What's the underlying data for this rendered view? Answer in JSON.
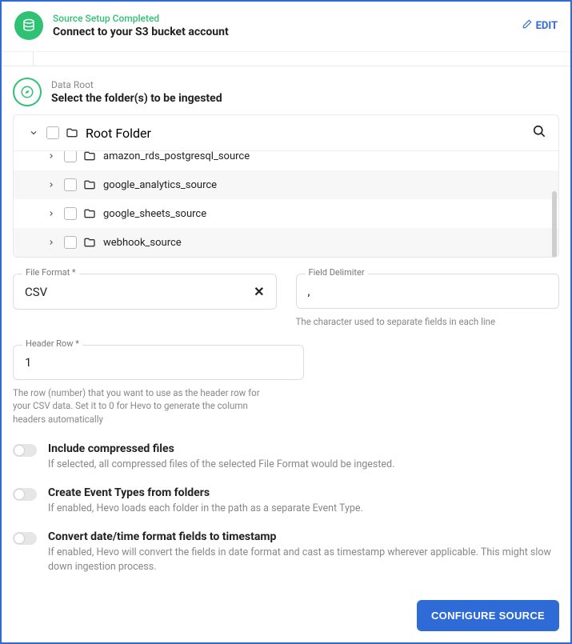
{
  "header": {
    "status": "Source Setup Completed",
    "title": "Connect to your S3 bucket account",
    "edit_label": "EDIT"
  },
  "section": {
    "label": "Data Root",
    "title": "Select the folder(s) to be ingested"
  },
  "tree": {
    "root_label": "Root Folder",
    "items": [
      {
        "label": "amazon_rds_postgresql_source"
      },
      {
        "label": "google_analytics_source"
      },
      {
        "label": "google_sheets_source"
      },
      {
        "label": "webhook_source"
      }
    ]
  },
  "file_format": {
    "label": "File Format *",
    "value": "CSV"
  },
  "field_delim": {
    "label": "Field Delimiter",
    "value": ",",
    "help": "The character used to separate fields in each line"
  },
  "header_row": {
    "label": "Header Row *",
    "value": "1",
    "help": "The row (number) that you want to use as the header row for your CSV data. Set it to 0 for Hevo to generate the column headers automatically"
  },
  "toggles": [
    {
      "title": "Include compressed files",
      "desc": "If selected, all compressed files of the selected File Format would be ingested."
    },
    {
      "title": "Create Event Types from folders",
      "desc": "If enabled, Hevo loads each folder in the path as a separate Event Type."
    },
    {
      "title": "Convert date/time format fields to timestamp",
      "desc": "If enabled, Hevo will convert the fields in date format and cast as timestamp wherever applicable. This might slow down ingestion process."
    }
  ],
  "footer": {
    "configure_label": "CONFIGURE SOURCE"
  },
  "icons": {
    "database": "database-icon",
    "compass": "compass-icon",
    "folder": "folder-icon",
    "chevron_right": "chevron-right-icon",
    "chevron_down": "chevron-down-icon",
    "search": "search-icon",
    "clear": "clear-icon",
    "edit": "edit-icon"
  }
}
